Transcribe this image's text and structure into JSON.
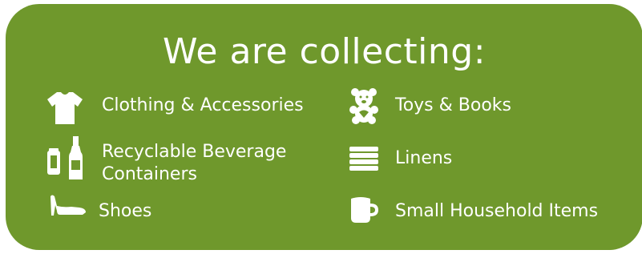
{
  "title": "We are collecting:",
  "colors": {
    "panel": "#6f982c",
    "text": "#ffffff"
  },
  "items": [
    {
      "label": "Clothing & Accessories",
      "icon": "tshirt-icon"
    },
    {
      "label": "Recyclable Beverage",
      "label2": "Containers",
      "icon": "can-bottle-icon"
    },
    {
      "label": "Shoes",
      "icon": "high-heel-shoe-icon"
    },
    {
      "label": "Toys & Books",
      "icon": "teddy-bear-icon"
    },
    {
      "label": "Linens",
      "icon": "folded-linens-icon"
    },
    {
      "label": "Small Household Items",
      "icon": "mug-icon"
    }
  ]
}
